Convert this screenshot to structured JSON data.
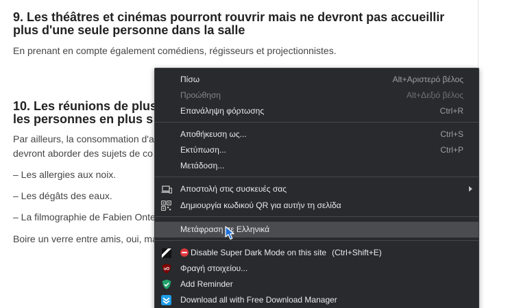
{
  "article": {
    "section9_heading_line1": "9. Les théâtres et cinémas pourront rouvrir mais ne devront pas accueillir",
    "section9_heading_line2": "plus d'une seule personne dans la salle",
    "section9_text": "En prenant en compte également comédiens, régisseurs et projectionnistes.",
    "section10_heading_line1": "10. Les réunions de plus",
    "section10_heading_line2": "les personnes en plus s",
    "para_line1": "Par ailleurs, la consommation d'a",
    "para_line2": "devront aborder des sujets de co",
    "list": [
      "– Les allergies aux noix.",
      "– Les dégâts des eaux.",
      "– La filmographie de Fabien Onte"
    ],
    "closing": "Boire un verre entre amis, oui, ma"
  },
  "context_menu": {
    "back": {
      "label": "Πίσω",
      "shortcut": "Alt+Αριστερό βέλος"
    },
    "forward": {
      "label": "Προώθηση",
      "shortcut": "Alt+Δεξιό βέλος"
    },
    "reload": {
      "label": "Επανάληψη φόρτωσης",
      "shortcut": "Ctrl+R"
    },
    "save_as": {
      "label": "Αποθήκευση ως...",
      "shortcut": "Ctrl+S"
    },
    "print": {
      "label": "Εκτύπωση...",
      "shortcut": "Ctrl+P"
    },
    "cast": {
      "label": "Μετάδοση..."
    },
    "send_to_devices": {
      "label": "Αποστολή στις συσκευές σας",
      "icon": "devices-icon"
    },
    "create_qr": {
      "label": "Δημιουργία κωδικού QR για αυτήν τη σελίδα",
      "icon": "qr-code-icon"
    },
    "translate": {
      "label": "Μετάφραση σε Ελληνικά"
    },
    "disable_dark_mode": {
      "label": "Disable Super Dark Mode on this site",
      "shortcut_inline": "(Ctrl+Shift+E)",
      "icon": "super-dark-mode-icon"
    },
    "block_element": {
      "label": "Φραγή στοιχείου...",
      "icon": "ublock-origin-icon"
    },
    "add_reminder": {
      "label": "Add Reminder",
      "icon": "reminder-icon"
    },
    "download_all": {
      "label": "Download all with Free Download Manager",
      "icon": "fdm-icon"
    }
  },
  "colors": {
    "menu_background": "#292a2d",
    "menu_highlight": "#4a4c50",
    "menu_text": "#e8eaed",
    "article_text": "#444444",
    "heading_text": "#222222"
  }
}
